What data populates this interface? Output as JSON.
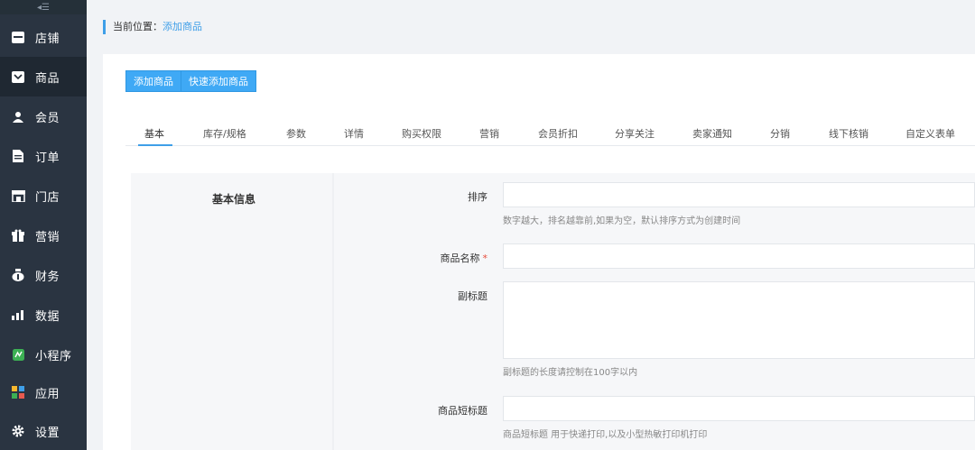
{
  "sidebar": {
    "collapse_icon": "collapse-icon",
    "items": [
      {
        "label": "店铺",
        "icon": "store-icon"
      },
      {
        "label": "商品",
        "icon": "goods-icon"
      },
      {
        "label": "会员",
        "icon": "user-icon"
      },
      {
        "label": "订单",
        "icon": "order-icon"
      },
      {
        "label": "门店",
        "icon": "shop-icon"
      },
      {
        "label": "营销",
        "icon": "gift-icon"
      },
      {
        "label": "财务",
        "icon": "money-bag-icon"
      },
      {
        "label": "数据",
        "icon": "chart-icon"
      },
      {
        "label": "小程序",
        "icon": "miniprogram-icon"
      },
      {
        "label": "应用",
        "icon": "apps-icon"
      },
      {
        "label": "设置",
        "icon": "gear-icon"
      }
    ],
    "active_index": 1
  },
  "breadcrumb": {
    "prefix": "当前位置：",
    "current": "添加商品"
  },
  "toolbar": {
    "add_label": "添加商品",
    "quick_add_label": "快速添加商品"
  },
  "tabs": [
    "基本",
    "库存/规格",
    "参数",
    "详情",
    "购买权限",
    "营销",
    "会员折扣",
    "分享关注",
    "卖家通知",
    "分销",
    "线下核销",
    "自定义表单"
  ],
  "form": {
    "section_title": "基本信息",
    "fields": [
      {
        "label": "排序",
        "value": "",
        "help": "数字越大，排名越靠前,如果为空，默认排序方式为创建时间"
      },
      {
        "label": "商品名称",
        "required_mark": "*",
        "value": ""
      },
      {
        "label": "副标题",
        "value": "",
        "help": "副标题的长度请控制在100字以内"
      },
      {
        "label": "商品短标题",
        "value": "",
        "help": "商品短标题 用于快递打印,以及小型热敏打印机打印"
      }
    ]
  },
  "colors": {
    "sidebar_bg": "#2a3441",
    "accent": "#3f9fe8",
    "button": "#3fa9f5"
  }
}
